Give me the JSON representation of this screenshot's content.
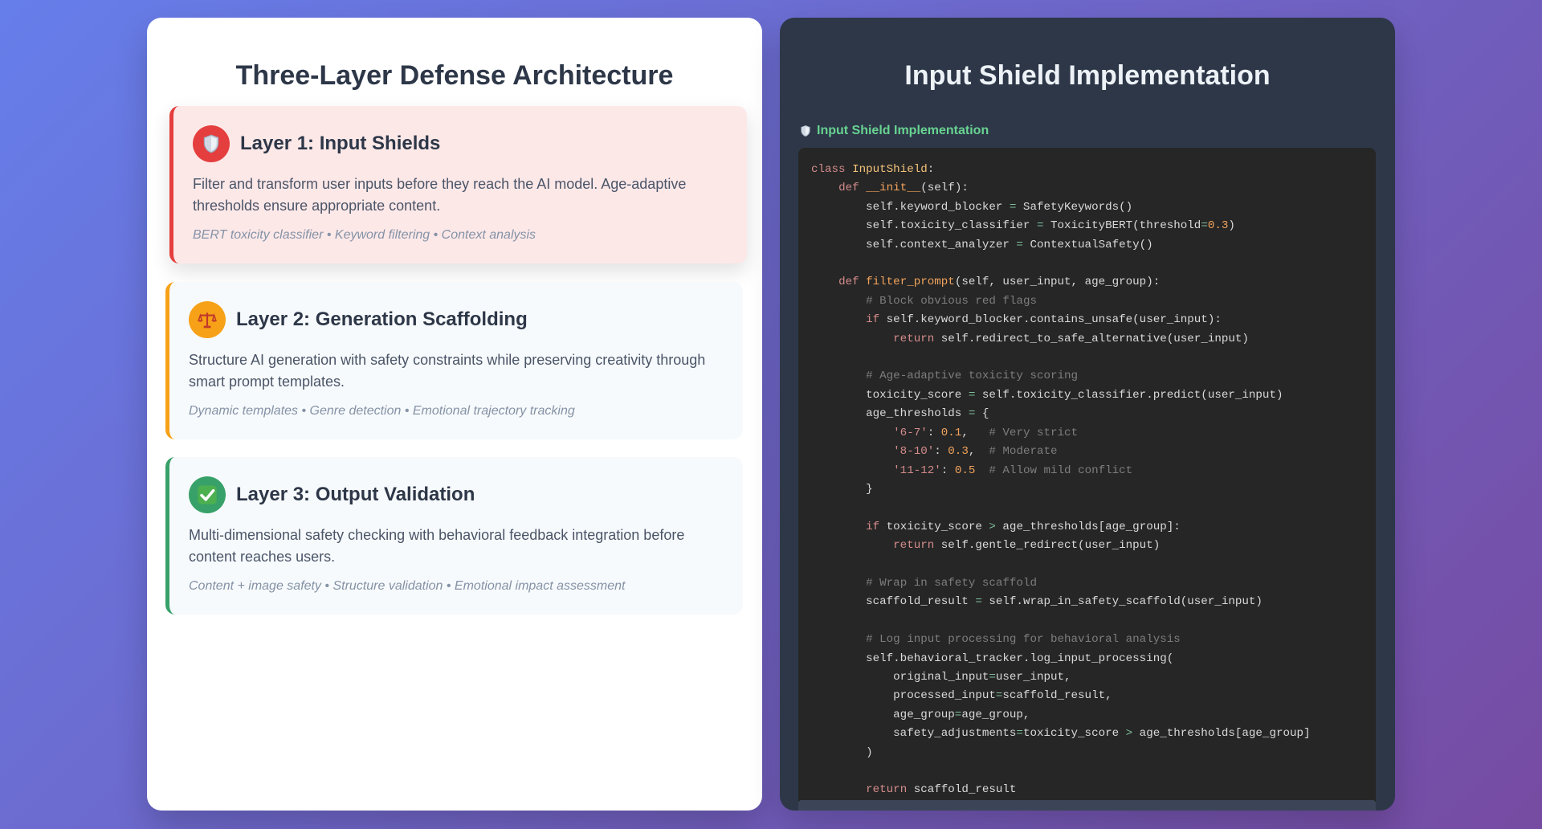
{
  "left_panel": {
    "title": "Three-Layer Defense Architecture",
    "layers": [
      {
        "name": "Layer 1: Input Shields",
        "icon": "shield-icon",
        "accent": "#e53e3e",
        "description": "Filter and transform user inputs before they reach the AI model. Age-adaptive thresholds ensure appropriate content.",
        "tags": "BERT toxicity classifier • Keyword filtering • Context analysis"
      },
      {
        "name": "Layer 2: Generation Scaffolding",
        "icon": "scales-icon",
        "accent": "#f6a117",
        "description": "Structure AI generation with safety constraints while preserving creativity through smart prompt templates.",
        "tags": "Dynamic templates • Genre detection • Emotional trajectory tracking"
      },
      {
        "name": "Layer 3: Output Validation",
        "icon": "checkmark-icon",
        "accent": "#38a169",
        "description": "Multi-dimensional safety checking with behavioral feedback integration before content reaches users.",
        "tags": "Content + image safety • Structure validation • Emotional impact assessment"
      }
    ]
  },
  "right_panel": {
    "title": "Input Shield Implementation",
    "code_label": "Input Shield Implementation",
    "code_label_icon": "shield-icon",
    "code_lines": [
      [
        [
          "kw",
          "class "
        ],
        [
          "cls",
          "InputShield"
        ],
        [
          "",
          ":"
        ]
      ],
      [
        [
          "",
          "    "
        ],
        [
          "kw",
          "def "
        ],
        [
          "fn",
          "__init__"
        ],
        [
          "",
          "(self):"
        ]
      ],
      [
        [
          "",
          "        self.keyword_blocker "
        ],
        [
          "op",
          "="
        ],
        [
          "",
          " SafetyKeywords()"
        ]
      ],
      [
        [
          "",
          "        self.toxicity_classifier "
        ],
        [
          "op",
          "="
        ],
        [
          "",
          " ToxicityBERT(threshold"
        ],
        [
          "op",
          "="
        ],
        [
          "num",
          "0.3"
        ],
        [
          "",
          ")"
        ]
      ],
      [
        [
          "",
          "        self.context_analyzer "
        ],
        [
          "op",
          "="
        ],
        [
          "",
          " ContextualSafety()"
        ]
      ],
      [
        [
          "",
          ""
        ]
      ],
      [
        [
          "",
          "    "
        ],
        [
          "kw",
          "def "
        ],
        [
          "fn",
          "filter_prompt"
        ],
        [
          "",
          "(self, user_input, age_group):"
        ]
      ],
      [
        [
          "",
          "        "
        ],
        [
          "cm",
          "# Block obvious red flags"
        ]
      ],
      [
        [
          "",
          "        "
        ],
        [
          "kw",
          "if "
        ],
        [
          "",
          "self.keyword_blocker.contains_unsafe(user_input):"
        ]
      ],
      [
        [
          "",
          "            "
        ],
        [
          "kw",
          "return "
        ],
        [
          "",
          "self.redirect_to_safe_alternative(user_input)"
        ]
      ],
      [
        [
          "",
          ""
        ]
      ],
      [
        [
          "",
          "        "
        ],
        [
          "cm",
          "# Age-adaptive toxicity scoring"
        ]
      ],
      [
        [
          "",
          "        toxicity_score "
        ],
        [
          "op",
          "="
        ],
        [
          "",
          " self.toxicity_classifier.predict(user_input)"
        ]
      ],
      [
        [
          "",
          "        age_thresholds "
        ],
        [
          "op",
          "="
        ],
        [
          "",
          " {"
        ]
      ],
      [
        [
          "",
          "            "
        ],
        [
          "str",
          "'6-7'"
        ],
        [
          "",
          ": "
        ],
        [
          "num",
          "0.1"
        ],
        [
          "",
          ",   "
        ],
        [
          "cm",
          "# Very strict"
        ]
      ],
      [
        [
          "",
          "            "
        ],
        [
          "str",
          "'8-10'"
        ],
        [
          "",
          ": "
        ],
        [
          "num",
          "0.3"
        ],
        [
          "",
          ",  "
        ],
        [
          "cm",
          "# Moderate"
        ]
      ],
      [
        [
          "",
          "            "
        ],
        [
          "str",
          "'11-12'"
        ],
        [
          "",
          ": "
        ],
        [
          "num",
          "0.5"
        ],
        [
          "",
          "  "
        ],
        [
          "cm",
          "# Allow mild conflict"
        ]
      ],
      [
        [
          "",
          "        }"
        ]
      ],
      [
        [
          "",
          ""
        ]
      ],
      [
        [
          "",
          "        "
        ],
        [
          "kw",
          "if "
        ],
        [
          "",
          "toxicity_score "
        ],
        [
          "op",
          ">"
        ],
        [
          "",
          " age_thresholds[age_group]:"
        ]
      ],
      [
        [
          "",
          "            "
        ],
        [
          "kw",
          "return "
        ],
        [
          "",
          "self.gentle_redirect(user_input)"
        ]
      ],
      [
        [
          "",
          ""
        ]
      ],
      [
        [
          "",
          "        "
        ],
        [
          "cm",
          "# Wrap in safety scaffold"
        ]
      ],
      [
        [
          "",
          "        scaffold_result "
        ],
        [
          "op",
          "="
        ],
        [
          "",
          " self.wrap_in_safety_scaffold(user_input)"
        ]
      ],
      [
        [
          "",
          ""
        ]
      ],
      [
        [
          "",
          "        "
        ],
        [
          "cm",
          "# Log input processing for behavioral analysis"
        ]
      ],
      [
        [
          "",
          "        self.behavioral_tracker.log_input_processing("
        ]
      ],
      [
        [
          "",
          "            original_input"
        ],
        [
          "op",
          "="
        ],
        [
          "",
          "user_input,"
        ]
      ],
      [
        [
          "",
          "            processed_input"
        ],
        [
          "op",
          "="
        ],
        [
          "",
          "scaffold_result,"
        ]
      ],
      [
        [
          "",
          "            age_group"
        ],
        [
          "op",
          "="
        ],
        [
          "",
          "age_group,"
        ]
      ],
      [
        [
          "",
          "            safety_adjustments"
        ],
        [
          "op",
          "="
        ],
        [
          "",
          "toxicity_score "
        ],
        [
          "op",
          ">"
        ],
        [
          "",
          " age_thresholds[age_group]"
        ]
      ],
      [
        [
          "",
          "        )"
        ]
      ],
      [
        [
          "",
          ""
        ]
      ],
      [
        [
          "",
          "        "
        ],
        [
          "kw",
          "return "
        ],
        [
          "",
          "scaffold_result"
        ]
      ]
    ]
  }
}
